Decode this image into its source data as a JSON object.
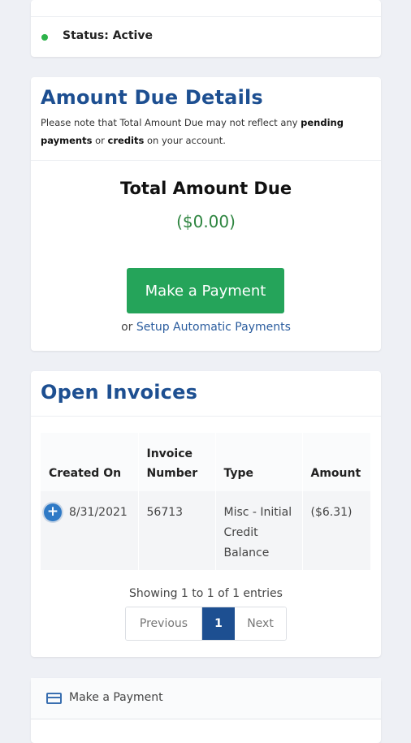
{
  "status": {
    "label": "Status: Active",
    "dot_color": "#2db34a"
  },
  "amount_due": {
    "title": "Amount Due Details",
    "note_prefix": "Please note that Total Amount Due may not reflect any",
    "note_bold1": "pending payments",
    "note_mid": "or",
    "note_bold2": "credits",
    "note_suffix": "on your account.",
    "total_label": "Total Amount Due",
    "total_value": "($0.00)",
    "pay_button": "Make a Payment",
    "setup_prefix": "or",
    "setup_link": "Setup Automatic Payments"
  },
  "invoices": {
    "title": "Open Invoices",
    "columns": [
      "Created On",
      "Invoice Number",
      "Type",
      "Amount"
    ],
    "rows": [
      {
        "created_on": "8/31/2021",
        "invoice_number": "56713",
        "type": "Misc - Initial Credit Balance",
        "amount": "($6.31)"
      }
    ],
    "entries_text": "Showing 1 to 1 of 1 entries",
    "pager": {
      "previous": "Previous",
      "current": "1",
      "next": "Next"
    }
  },
  "make_payment_panel": {
    "title": "Make a Payment",
    "icon": "credit-card-icon"
  },
  "colors": {
    "brand_blue": "#1d4f91",
    "pay_green": "#25a45a",
    "amount_green": "#2e8540"
  }
}
